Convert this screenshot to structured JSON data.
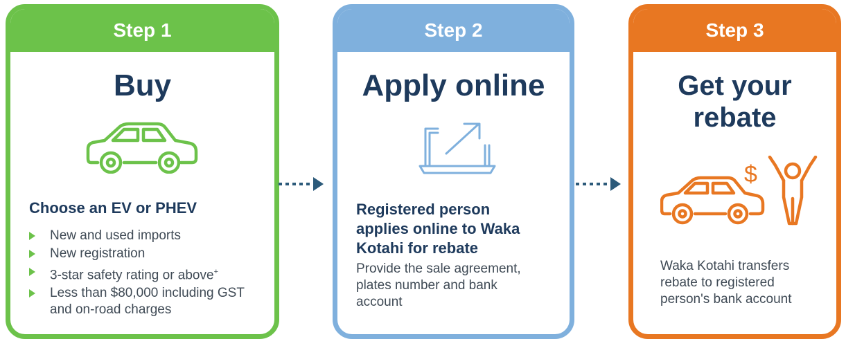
{
  "colors": {
    "green": "#6cc24a",
    "blue": "#7fb0dd",
    "orange": "#e87722",
    "navy": "#1e3a5c",
    "text": "#3f4a55"
  },
  "steps": [
    {
      "label": "Step 1",
      "title": "Buy",
      "icon": "car-icon",
      "subhead": "Choose an EV or PHEV",
      "bullets": [
        {
          "text": "New and used imports",
          "sup": ""
        },
        {
          "text": "New registration",
          "sup": ""
        },
        {
          "text": "3-star safety rating or above",
          "sup": "+"
        },
        {
          "text": "Less than $80,000 including GST and on-road charges",
          "sup": ""
        }
      ]
    },
    {
      "label": "Step 2",
      "title": "Apply online",
      "icon": "laptop-icon",
      "subhead": "Registered person applies online to Waka Kotahi for rebate",
      "body": "Provide the sale agreement, plates number and bank account"
    },
    {
      "label": "Step 3",
      "title": "Get your rebate",
      "icon": "car-rebate-celebration-icon",
      "icon_symbol": "$",
      "body": "Waka Kotahi transfers rebate to registered person's bank account"
    }
  ]
}
